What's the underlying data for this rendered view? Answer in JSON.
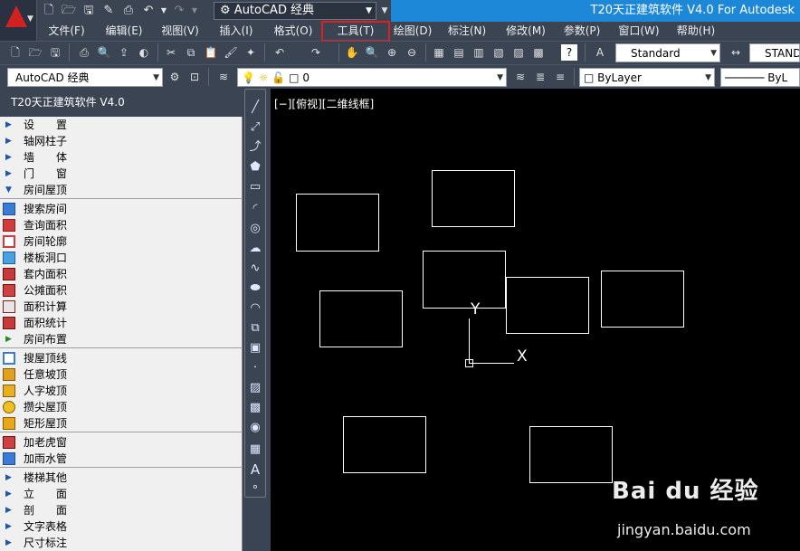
{
  "app_title": "T20天正建筑软件 V4.0 For Autodesk",
  "workspace": "AutoCAD 经典",
  "menu": [
    "文件(F)",
    "编辑(E)",
    "视图(V)",
    "插入(I)",
    "格式(O)",
    "工具(T)",
    "绘图(D)",
    "标注(N)",
    "修改(M)",
    "参数(P)",
    "窗口(W)",
    "帮助(H)"
  ],
  "toolbar": {
    "text_style": "Standard",
    "dim_style": "STAND",
    "workspace_combo": "AutoCAD 经典",
    "layer_value": "0",
    "color_value": "ByLayer",
    "linetype_value": "ByL"
  },
  "panel": {
    "title": "T20天正建筑软件 V4.0",
    "sections": [
      {
        "label": "设　　置",
        "expanded": false
      },
      {
        "label": "轴网柱子",
        "expanded": false
      },
      {
        "label": "墙　　体",
        "expanded": false
      },
      {
        "label": "门　　窗",
        "expanded": false
      },
      {
        "label": "房间屋顶",
        "expanded": true
      }
    ],
    "room_items": [
      "搜索房间",
      "查询面积",
      "房间轮廓",
      "楼板洞口",
      "套内面积",
      "公摊面积",
      "面积计算",
      "面积统计"
    ],
    "room_layout": "房间布置",
    "roof_items": [
      "搜屋顶线",
      "任意坡顶",
      "人字坡顶",
      "攒尖屋顶",
      "矩形屋顶"
    ],
    "extra_items": [
      "加老虎窗",
      "加雨水管"
    ],
    "more_sections": [
      "楼梯其他",
      "立　　面",
      "剖　　面",
      "文字表格",
      "尺寸标注"
    ]
  },
  "viewport_label": "[−][俯视][二维线框]",
  "ucs": {
    "x_label": "X",
    "y_label": "Y"
  },
  "watermark": {
    "brand": "Bai du 经验",
    "url": "jingyan.baidu.com"
  }
}
